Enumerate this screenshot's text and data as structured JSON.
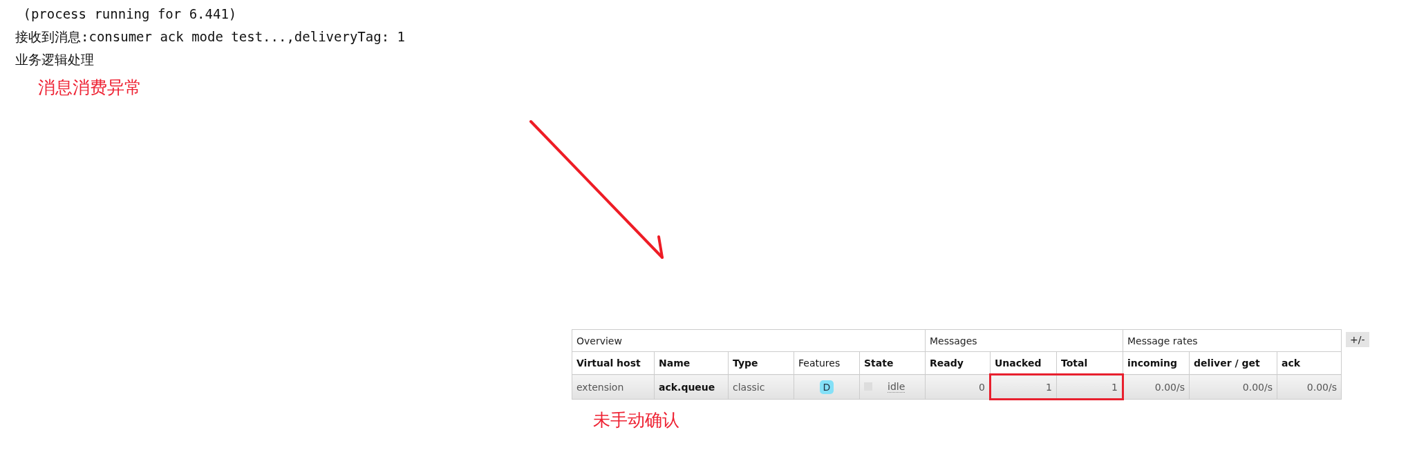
{
  "console": {
    "lines": [
      " (process running for 6.441)",
      "接收到消息:consumer ack mode test...,deliveryTag: 1",
      "业务逻辑处理"
    ]
  },
  "annotations": {
    "top_label": "消息消费异常",
    "bottom_label": "未手动确认"
  },
  "queue_table": {
    "groups": [
      {
        "label": "Overview",
        "columns": [
          {
            "label": "Virtual host",
            "bold": true
          },
          {
            "label": "Name",
            "bold": true
          },
          {
            "label": "Type",
            "bold": true
          },
          {
            "label": "Features",
            "bold": false
          },
          {
            "label": "State",
            "bold": true
          }
        ]
      },
      {
        "label": "Messages",
        "columns": [
          {
            "label": "Ready",
            "bold": true
          },
          {
            "label": "Unacked",
            "bold": true
          },
          {
            "label": "Total",
            "bold": true
          }
        ]
      },
      {
        "label": "Message rates",
        "columns": [
          {
            "label": "incoming",
            "bold": true
          },
          {
            "label": "deliver / get",
            "bold": true
          },
          {
            "label": "ack",
            "bold": true
          }
        ]
      }
    ],
    "rows": [
      {
        "cells": [
          {
            "kind": "text",
            "text": "extension",
            "highlighted": false
          },
          {
            "kind": "name",
            "text": "ack.queue",
            "highlighted": false
          },
          {
            "kind": "text",
            "text": "classic",
            "highlighted": false
          },
          {
            "kind": "badge",
            "text": "D",
            "highlighted": false
          },
          {
            "kind": "state",
            "text": "idle",
            "highlighted": false
          },
          {
            "kind": "number",
            "text": "0",
            "highlighted": false
          },
          {
            "kind": "number",
            "text": "1",
            "highlighted": true
          },
          {
            "kind": "number",
            "text": "1",
            "highlighted": true
          },
          {
            "kind": "number",
            "text": "0.00/s",
            "highlighted": false
          },
          {
            "kind": "number",
            "text": "0.00/s",
            "highlighted": false
          },
          {
            "kind": "number",
            "text": "0.00/s",
            "highlighted": false
          }
        ]
      }
    ],
    "toggle_button": "+/-"
  }
}
